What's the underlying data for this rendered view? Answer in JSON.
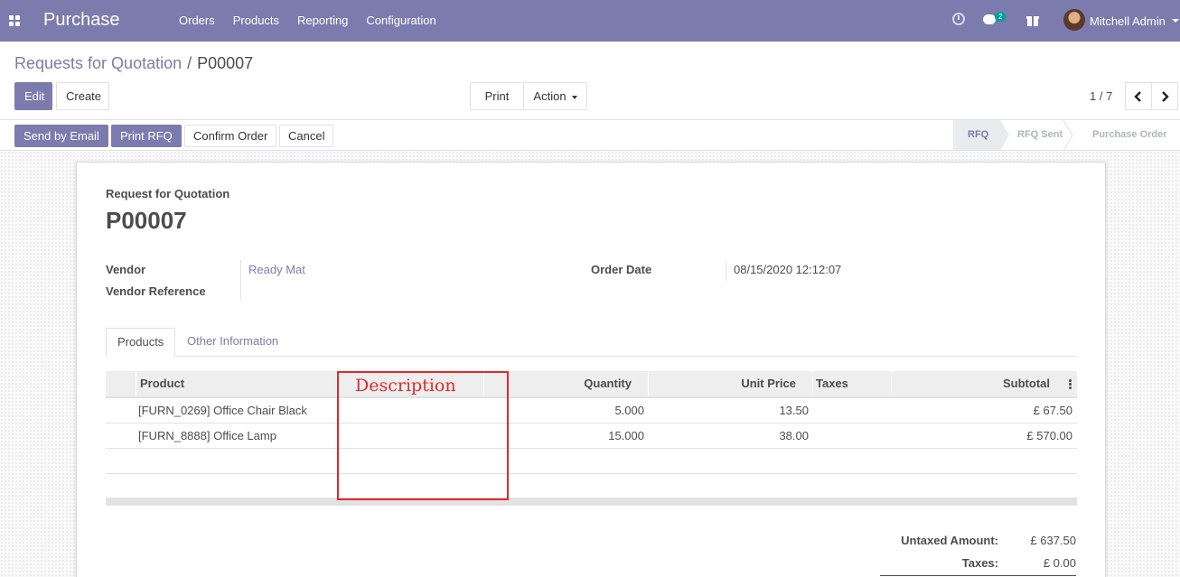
{
  "navbar": {
    "app_name": "Purchase",
    "menu": [
      "Orders",
      "Products",
      "Reporting",
      "Configuration"
    ],
    "chat_count": "2",
    "user_name": "Mitchell Admin",
    "accent_color": "#7c7bad"
  },
  "breadcrumb": {
    "parent": "Requests for Quotation",
    "separator": "/",
    "current": "P00007"
  },
  "buttons": {
    "edit": "Edit",
    "create": "Create",
    "print": "Print",
    "action": "Action"
  },
  "pager": {
    "value": "1 / 7"
  },
  "statusbar": {
    "buttons": [
      "Send by Email",
      "Print RFQ",
      "Confirm Order",
      "Cancel"
    ],
    "stages": [
      "RFQ",
      "RFQ Sent",
      "Purchase Order"
    ],
    "active_stage": "RFQ"
  },
  "form": {
    "doc_type": "Request for Quotation",
    "doc_name": "P00007",
    "vendor_label": "Vendor",
    "vendor_value": "Ready Mat",
    "vendor_ref_label": "Vendor Reference",
    "vendor_ref_value": "",
    "order_date_label": "Order Date",
    "order_date_value": "08/15/2020 12:12:07"
  },
  "tabs": [
    "Products",
    "Other Information"
  ],
  "table": {
    "headers": [
      "Product",
      "Description",
      "Quantity",
      "Unit Price",
      "Taxes",
      "Subtotal"
    ],
    "rows": [
      {
        "product": "[FURN_0269] Office Chair Black",
        "description": "",
        "quantity": "5.000",
        "unit_price": "13.50",
        "taxes": "",
        "subtotal": "£ 67.50"
      },
      {
        "product": "[FURN_8888] Office Lamp",
        "description": "",
        "quantity": "15.000",
        "unit_price": "38.00",
        "taxes": "",
        "subtotal": "£ 570.00"
      }
    ]
  },
  "totals": {
    "untaxed_label": "Untaxed Amount:",
    "untaxed_value": "£ 637.50",
    "taxes_label": "Taxes:",
    "taxes_value": "£ 0.00"
  },
  "annotation": {
    "label": "Description",
    "color": "#e3282b"
  }
}
